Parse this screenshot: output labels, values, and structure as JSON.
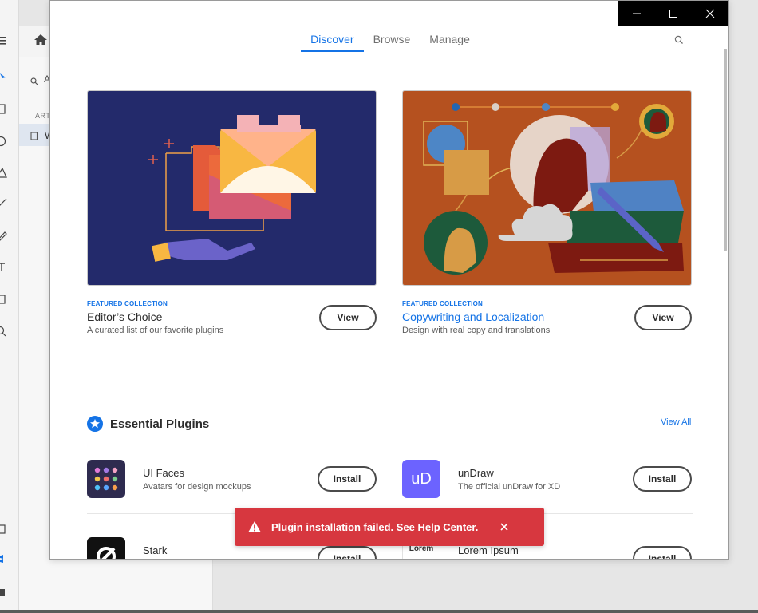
{
  "background": {
    "search_text": "A",
    "section_label": "ART",
    "layer_text": "W"
  },
  "window": {
    "controls": [
      "minimize",
      "maximize",
      "close"
    ]
  },
  "nav": {
    "tabs": [
      {
        "label": "Discover",
        "active": true
      },
      {
        "label": "Browse",
        "active": false
      },
      {
        "label": "Manage",
        "active": false
      }
    ]
  },
  "featured": [
    {
      "tag": "FEATURED COLLECTION",
      "title": "Editor’s Choice",
      "subtitle": "A curated list of our favorite plugins",
      "button": "View"
    },
    {
      "tag": "FEATURED COLLECTION",
      "title": "Copywriting and Localization",
      "subtitle": "Design with real copy and translations",
      "button": "View"
    }
  ],
  "essential": {
    "title": "Essential Plugins",
    "view_all": "View All",
    "plugins": [
      {
        "name": "UI Faces",
        "description": "Avatars for design mockups",
        "button": "Install"
      },
      {
        "name": "unDraw",
        "description": "The official unDraw for XD",
        "button": "Install",
        "icon_text": "uD"
      },
      {
        "name": "Stark",
        "description": "",
        "button": "Install"
      },
      {
        "name": "Lorem Ipsum",
        "description": "",
        "button": "Install",
        "icon_text": "Lorem"
      }
    ]
  },
  "toast": {
    "message": "Plugin installation failed. See ",
    "link": "Help Center",
    "suffix": "."
  },
  "colors": {
    "accent": "#1473e6",
    "error": "#d7373f",
    "editors_bg": "#232a6b",
    "copy_bg": "#b5511f"
  }
}
